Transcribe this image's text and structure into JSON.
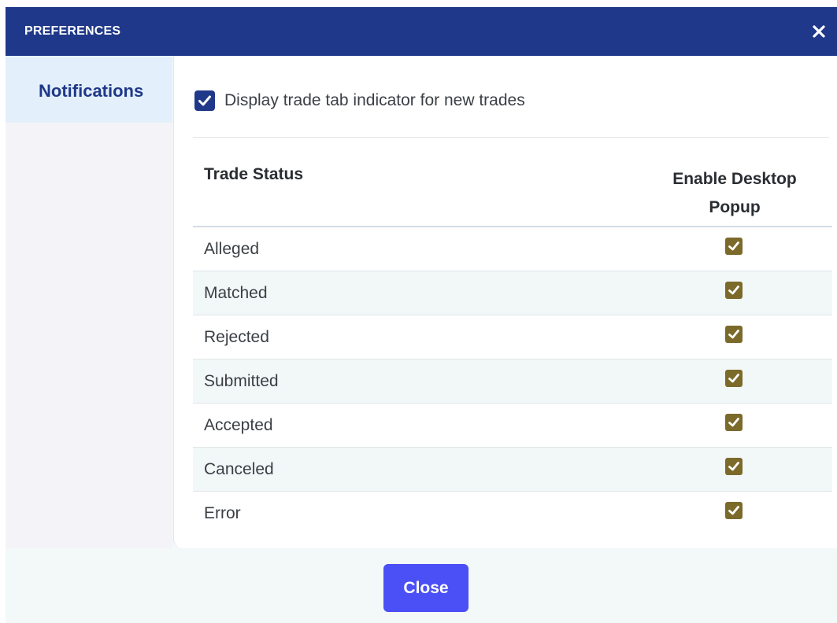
{
  "dialog": {
    "title": "PREFERENCES",
    "close_icon": "close-icon"
  },
  "sidebar": {
    "items": [
      {
        "label": "Notifications",
        "selected": true
      }
    ]
  },
  "settings": {
    "tab_indicator": {
      "label": "Display trade tab indicator for new trades",
      "checked": true
    }
  },
  "table": {
    "headers": {
      "status": "Trade Status",
      "popup": "Enable Desktop Popup"
    },
    "rows": [
      {
        "status": "Alleged",
        "popup": true
      },
      {
        "status": "Matched",
        "popup": true
      },
      {
        "status": "Rejected",
        "popup": true
      },
      {
        "status": "Submitted",
        "popup": true
      },
      {
        "status": "Accepted",
        "popup": true
      },
      {
        "status": "Canceled",
        "popup": true
      },
      {
        "status": "Error",
        "popup": true
      }
    ]
  },
  "footer": {
    "close_label": "Close"
  },
  "colors": {
    "header_bg": "#1f3889",
    "accent": "#1f3889",
    "row_check": "#7c6a2a",
    "button": "#4b4ff6"
  }
}
